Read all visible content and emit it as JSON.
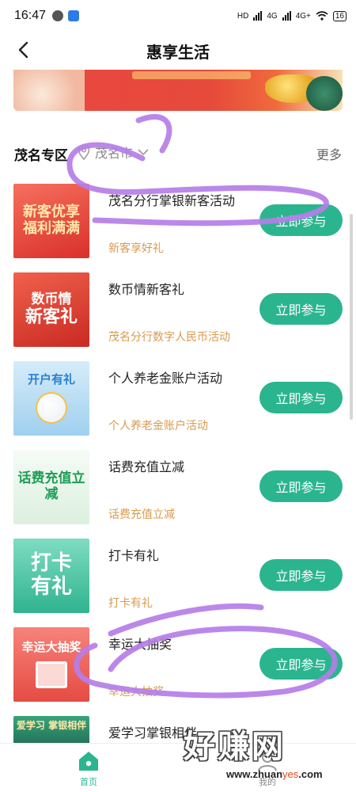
{
  "status_bar": {
    "time": "16:47",
    "network_labels": [
      "HD",
      "4G",
      "4G+"
    ],
    "battery": "16"
  },
  "header": {
    "title": "惠享生活"
  },
  "section": {
    "title": "茂名专区",
    "city": "茂名市",
    "more": "更多"
  },
  "activities": [
    {
      "title": "茂名分行掌银新客活动",
      "subtitle": "新客享好礼",
      "button": "立即参与",
      "thumb_text": [
        "新客优享",
        "福利满满"
      ],
      "thumb_bg": "#e8463c"
    },
    {
      "title": "数币情新客礼",
      "subtitle": "茂名分行数字人民币活动",
      "button": "立即参与",
      "thumb_text": [
        "数币情",
        "新客礼"
      ],
      "thumb_bg": "#e2412f"
    },
    {
      "title": "个人养老金账户活动",
      "subtitle": "个人养老金账户活动",
      "button": "立即参与",
      "thumb_text": [
        "开户有礼"
      ],
      "thumb_bg": "#bfe0f4"
    },
    {
      "title": "话费充值立减",
      "subtitle": "话费充值立减",
      "button": "立即参与",
      "thumb_text": [
        "话费充值立减"
      ],
      "thumb_bg": "#e9f6ea"
    },
    {
      "title": "打卡有礼",
      "subtitle": "打卡有礼",
      "button": "立即参与",
      "thumb_text": [
        "打卡",
        "有礼"
      ],
      "thumb_bg": "#4fc9ad"
    },
    {
      "title": "幸运大抽奖",
      "subtitle": "幸运大抽奖",
      "button": "立即参与",
      "thumb_text": [
        "幸运大抽奖"
      ],
      "thumb_bg": "#f2635a"
    },
    {
      "title": "爱学习掌银相伴",
      "subtitle": "",
      "button": "",
      "thumb_text": [
        "爱学习 掌银相伴"
      ],
      "thumb_bg": "#2e8d6a"
    }
  ],
  "tabs": [
    {
      "label": "首页",
      "active": true
    },
    {
      "label": "我的",
      "active": false
    }
  ],
  "colors": {
    "accent": "#2bb58f",
    "subtitle": "#d99a4e",
    "annotation": "#b57ee8"
  },
  "watermark": {
    "main": "好赚网",
    "url_prefix": "www.",
    "url_mid": "zhuan",
    "url_hl": "yes",
    "url_suffix": ".com"
  }
}
